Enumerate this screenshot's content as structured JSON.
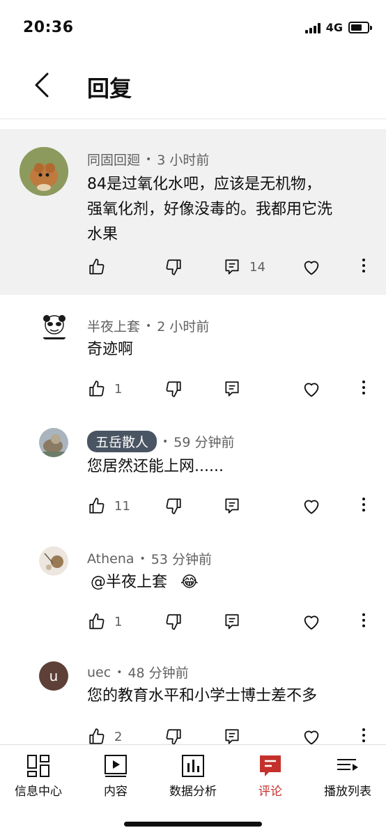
{
  "status_bar": {
    "time": "20:36",
    "network": "4G"
  },
  "header": {
    "title": "回复"
  },
  "main_comment": {
    "author": "同固回廻",
    "time": "3 小时前",
    "text_lines": [
      "84是过氧化水吧，应该是无机物，",
      "强氧化剂，好像没毒的。我都用它洗",
      "水果"
    ],
    "reply_count": "14"
  },
  "replies": [
    {
      "author": "半夜上套",
      "time": "2 小时前",
      "text": "奇迹啊",
      "likes": "1"
    },
    {
      "author": "五岳散人",
      "time": "59 分钟前",
      "text": "您居然还能上网......",
      "likes": "11"
    },
    {
      "author": "Athena",
      "time": "53 分钟前",
      "text": "@半夜上套",
      "emoji": "😂",
      "likes": "1"
    },
    {
      "author": "uec",
      "time": "48 分钟前",
      "text": "您的教育水平和小学士博士差不多",
      "likes": "2",
      "avatar_letter": "u"
    }
  ],
  "tabs": [
    {
      "label": "信息中心",
      "icon": "dashboard-icon"
    },
    {
      "label": "内容",
      "icon": "content-icon"
    },
    {
      "label": "数据分析",
      "icon": "analytics-icon"
    },
    {
      "label": "评论",
      "icon": "comments-icon",
      "active": true
    },
    {
      "label": "播放列表",
      "icon": "playlist-icon"
    }
  ],
  "colors": {
    "accent": "#c4302b",
    "highlight_bg": "#f1f1f1",
    "badge_bg": "#4a5563",
    "uec_avatar": "#5d4037"
  }
}
